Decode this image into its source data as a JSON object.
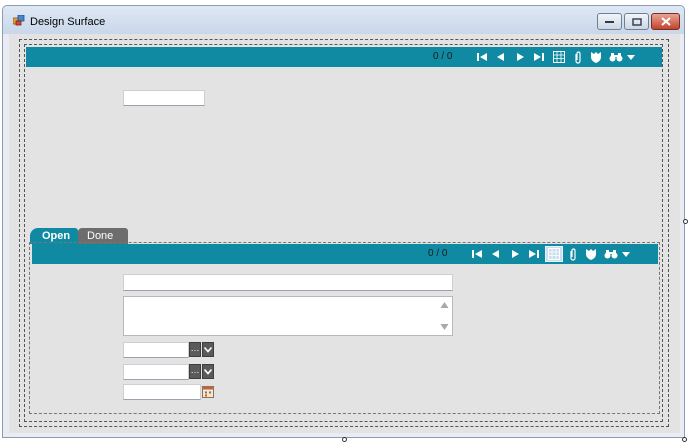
{
  "window": {
    "title": "Design Surface"
  },
  "top_toolbar": {
    "record_count": "0 / 0"
  },
  "tabs": [
    {
      "label": "Open"
    },
    {
      "label": "Done"
    }
  ],
  "inner_toolbar": {
    "record_count": "0 / 0"
  },
  "toolbar_icons": [
    "first-record-icon",
    "previous-record-icon",
    "next-record-icon",
    "last-record-icon",
    "grid-view-icon",
    "attachment-icon",
    "shield-icon",
    "binoculars-icon",
    "dropdown-arrow-icon"
  ],
  "colors": {
    "toolbar": "#0f8aa2",
    "tab_active": "#0f8aa2",
    "tab_inactive": "#6d6d6d",
    "surface": "#e3e3e3"
  }
}
